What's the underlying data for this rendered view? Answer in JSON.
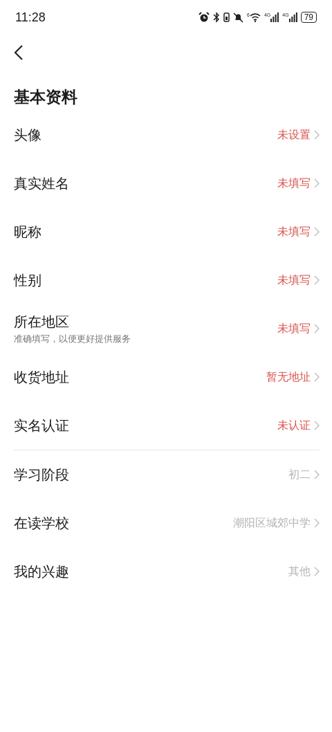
{
  "status_bar": {
    "time": "11:28",
    "wifi_label": "6",
    "signal_labels": [
      "4G",
      "4G"
    ],
    "battery": "79"
  },
  "title": "基本资料",
  "sections": [
    {
      "rows": [
        {
          "label": "头像",
          "value": "未设置",
          "filled": false
        },
        {
          "label": "真实姓名",
          "value": "未填写",
          "filled": false
        },
        {
          "label": "昵称",
          "value": "未填写",
          "filled": false
        },
        {
          "label": "性别",
          "value": "未填写",
          "filled": false
        },
        {
          "label": "所在地区",
          "hint": "准确填写，以便更好提供服务",
          "value": "未填写",
          "filled": false
        },
        {
          "label": "收货地址",
          "value": "暂无地址",
          "filled": false
        },
        {
          "label": "实名认证",
          "value": "未认证",
          "filled": false
        }
      ]
    },
    {
      "rows": [
        {
          "label": "学习阶段",
          "value": "初二",
          "filled": true
        },
        {
          "label": "在读学校",
          "value": "潮阳区城郊中学",
          "filled": true
        },
        {
          "label": "我的兴趣",
          "value": "其他",
          "filled": true
        }
      ]
    }
  ]
}
